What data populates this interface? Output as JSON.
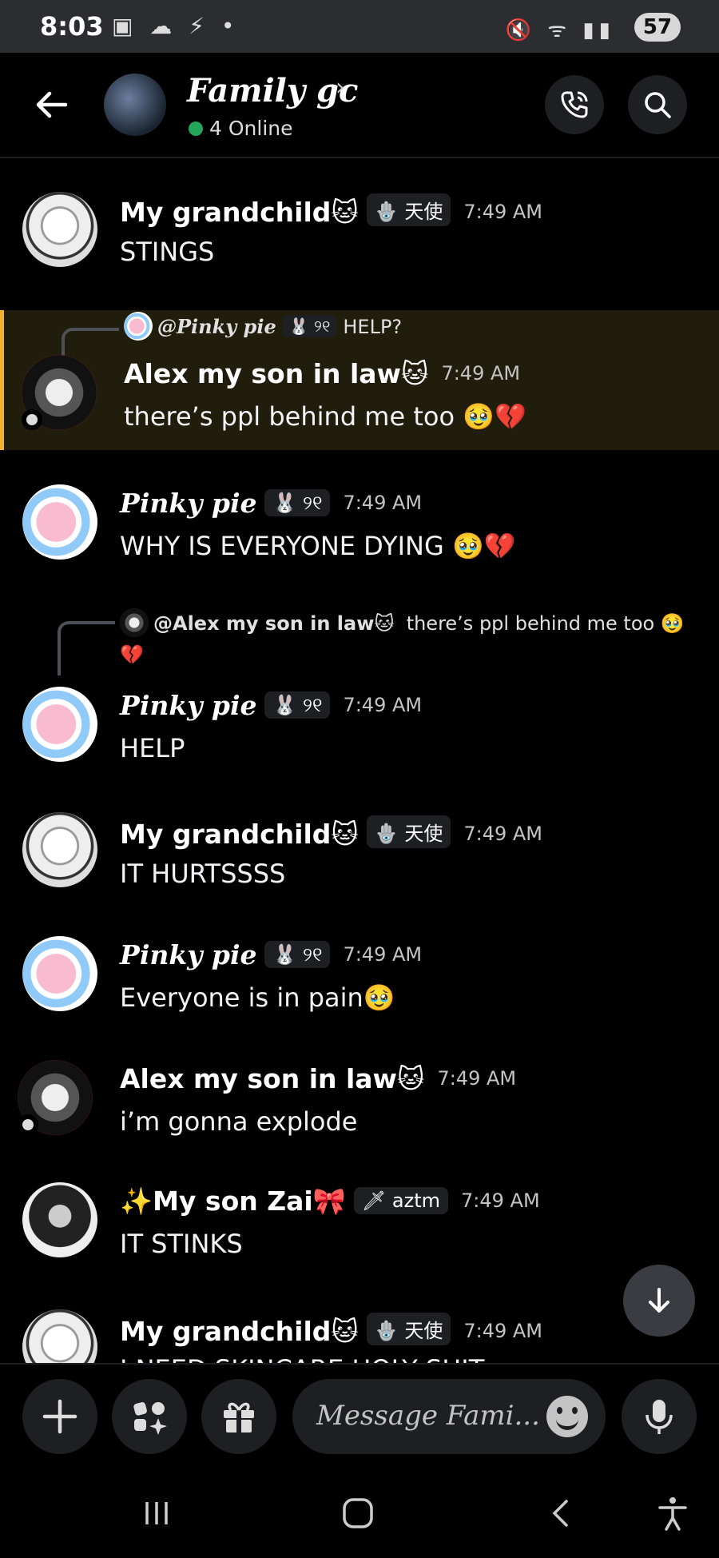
{
  "status_bar": {
    "time": "8:03",
    "left_icons": "▣ ☁ ⚡ •",
    "right_icons": "🔇 ᯤ ▮▮",
    "battery": "57"
  },
  "header": {
    "title": "Family gc",
    "chevron": "›",
    "online": "4 Online"
  },
  "messages": [
    {
      "author": "My grandchild🐱",
      "tag": "🪬 天使",
      "time": "7:49 AM",
      "text": "STINGS"
    },
    {
      "reply_author": "@Pinky pie",
      "reply_tag": "🐰 ୨୧",
      "reply_text": "HELP?",
      "author": "Alex my son in law🐱",
      "time": "7:49 AM",
      "text": "there’s ppl behind me too 🥹💔"
    },
    {
      "author": "Pinky pie",
      "tag": "🐰 ୨୧",
      "time": "7:49 AM",
      "text": "WHY IS EVERYONE DYING 🥹💔"
    },
    {
      "reply_author": "@Alex my son in law🐱",
      "reply_text": "there’s ppl behind me too 🥹",
      "reply_text_cont": "💔",
      "author": "Pinky pie",
      "tag": "🐰 ୨୧",
      "time": "7:49 AM",
      "text": "HELP"
    },
    {
      "author": "My grandchild🐱",
      "tag": "🪬 天使",
      "time": "7:49 AM",
      "text": "IT HURTSSSS"
    },
    {
      "author": "Pinky pie",
      "tag": "🐰 ୨୧",
      "time": "7:49 AM",
      "text": "Everyone is in pain🥹"
    },
    {
      "author": "Alex my son in law🐱",
      "time": "7:49 AM",
      "text": "i’m gonna explode"
    },
    {
      "author": "✨My son Zai🎀",
      "tag": "🗡 aztm",
      "time": "7:49 AM",
      "text": "IT STINKS"
    },
    {
      "author": "My grandchild🐱",
      "tag": "🪬 天使",
      "time": "7:49 AM",
      "text": "I NEED SKINCARE HOLY SHIT"
    }
  ],
  "composer": {
    "placeholder": "Message Fami..."
  },
  "icons": {
    "back": "arrow-left-icon",
    "call": "phone-icon",
    "search": "search-icon",
    "scroll_down": "arrow-down-icon",
    "add": "plus-icon",
    "apps": "apps-icon",
    "gift": "gift-icon",
    "emoji": "emoji-icon",
    "mic": "microphone-icon"
  },
  "colors": {
    "background": "#000000",
    "surface": "#1e1f22",
    "online_green": "#23a55a",
    "mention_highlight": "#f0b232"
  }
}
